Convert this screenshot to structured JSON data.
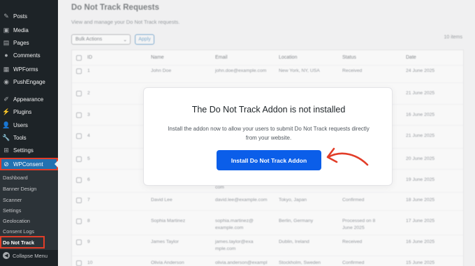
{
  "sidebar": {
    "items": [
      {
        "label": "Posts",
        "icon": "pin-icon"
      },
      {
        "label": "Media",
        "icon": "media-icon"
      },
      {
        "label": "Pages",
        "icon": "pages-icon"
      },
      {
        "label": "Comments",
        "icon": "comments-icon"
      },
      {
        "label": "WPForms",
        "icon": "wpforms-icon"
      },
      {
        "label": "PushEngage",
        "icon": "pushengage-icon"
      },
      {
        "label": "Appearance",
        "icon": "appearance-icon"
      },
      {
        "label": "Plugins",
        "icon": "plugins-icon"
      },
      {
        "label": "Users",
        "icon": "users-icon"
      },
      {
        "label": "Tools",
        "icon": "tools-icon"
      },
      {
        "label": "Settings",
        "icon": "settings-icon"
      },
      {
        "label": "WPConsent",
        "icon": "wpconsent-icon"
      }
    ],
    "submenu": [
      "Dashboard",
      "Banner Design",
      "Scanner",
      "Settings",
      "Geolocation",
      "Consent Logs",
      "Do Not Track"
    ],
    "collapse_label": "Collapse Menu"
  },
  "page": {
    "title": "Do Not Track Requests",
    "description": "View and manage your Do Not Track requests.",
    "bulk_actions": "Bulk Actions",
    "apply_label": "Apply",
    "items_count": "10 items"
  },
  "table": {
    "headers": [
      "ID",
      "Name",
      "Email",
      "Location",
      "Status",
      "Date"
    ],
    "rows": [
      {
        "id": "1",
        "name": "John Doe",
        "email": "john.doe@example.com",
        "location": "New York, NY, USA",
        "status": "Received",
        "date": "24 June 2025"
      },
      {
        "id": "2",
        "name": "",
        "email": "",
        "location": "",
        "status": "",
        "date": "21 June 2025"
      },
      {
        "id": "3",
        "name": "",
        "email": "",
        "location": "",
        "status": "",
        "date": "16 June 2025"
      },
      {
        "id": "4",
        "name": "",
        "email": "",
        "location": "",
        "status": "",
        "date": "21 June 2025"
      },
      {
        "id": "5",
        "name": "",
        "email": "",
        "location": "",
        "status": "",
        "date": "20 June 2025"
      },
      {
        "id": "6",
        "name": "",
        "email": "",
        "location": "",
        "status": "",
        "date": "19 June 2025"
      },
      {
        "id": "7",
        "name": "David Lee",
        "email": "david.lee@example.com",
        "location": "Tokyo, Japan",
        "status": "Confirmed",
        "date": "18 June 2025"
      },
      {
        "id": "8",
        "name": "Sophia Martinez",
        "email": "sophia.martinez@example.com",
        "location": "Berlin, Germany",
        "status": "Processed on 8 June 2025",
        "date": "17 June 2025"
      },
      {
        "id": "9",
        "name": "James Taylor",
        "email": "james.taylor@example.com",
        "location": "Dublin, Ireland",
        "status": "Received",
        "date": "16 June 2025"
      },
      {
        "id": "10",
        "name": "Olivia Anderson",
        "email": "olivia.anderson@exampl",
        "location": "Stockholm, Sweden",
        "status": "Confirmed",
        "date": "15 June 2025"
      }
    ],
    "row6_email_fragment": "com"
  },
  "modal": {
    "title": "The Do Not Track Addon is not installed",
    "text": "Install the addon now to allow your users to submit Do Not Track requests directly from your website.",
    "button_label": "Install Do Not Track Addon"
  },
  "colors": {
    "sidebar_bg": "#1d2327",
    "active_blue": "#2271b1",
    "button_blue": "#0b5ee9",
    "highlight_red": "#e23d28"
  }
}
